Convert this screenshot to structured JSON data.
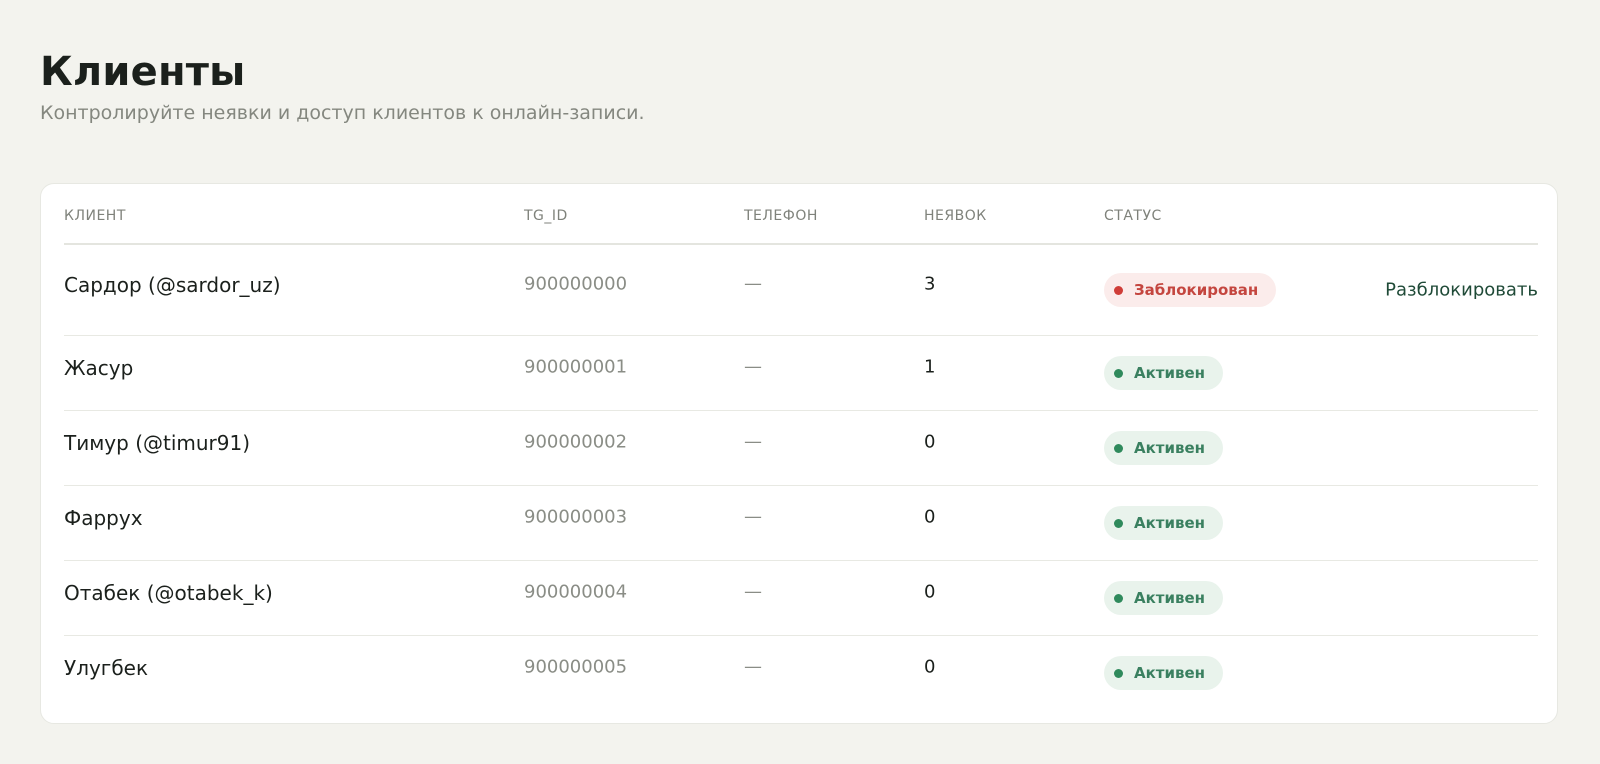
{
  "header": {
    "title": "Клиенты",
    "subtitle": "Контролируйте неявки и доступ клиентов к онлайн-записи."
  },
  "table": {
    "columns": [
      "КЛИЕНТ",
      "TG_ID",
      "ТЕЛЕФОН",
      "НЕЯВОК",
      "СТАТУС"
    ],
    "rows": [
      {
        "name": "Сардор (@sardor_uz)",
        "tg_id": "900000000",
        "phone": "—",
        "noshows": "3",
        "status": "Заблокирован",
        "status_type": "blocked",
        "action": "Разблокировать"
      },
      {
        "name": "Жасур",
        "tg_id": "900000001",
        "phone": "—",
        "noshows": "1",
        "status": "Активен",
        "status_type": "active",
        "action": ""
      },
      {
        "name": "Тимур (@timur91)",
        "tg_id": "900000002",
        "phone": "—",
        "noshows": "0",
        "status": "Активен",
        "status_type": "active",
        "action": ""
      },
      {
        "name": "Фаррух",
        "tg_id": "900000003",
        "phone": "—",
        "noshows": "0",
        "status": "Активен",
        "status_type": "active",
        "action": ""
      },
      {
        "name": "Отабек (@otabek_k)",
        "tg_id": "900000004",
        "phone": "—",
        "noshows": "0",
        "status": "Активен",
        "status_type": "active",
        "action": ""
      },
      {
        "name": "Улугбек",
        "tg_id": "900000005",
        "phone": "—",
        "noshows": "0",
        "status": "Активен",
        "status_type": "active",
        "action": ""
      }
    ]
  },
  "colors": {
    "background": "#f3f3ee",
    "blocked": "#c4463f",
    "active": "#3a8060",
    "action": "#1f4a37"
  }
}
